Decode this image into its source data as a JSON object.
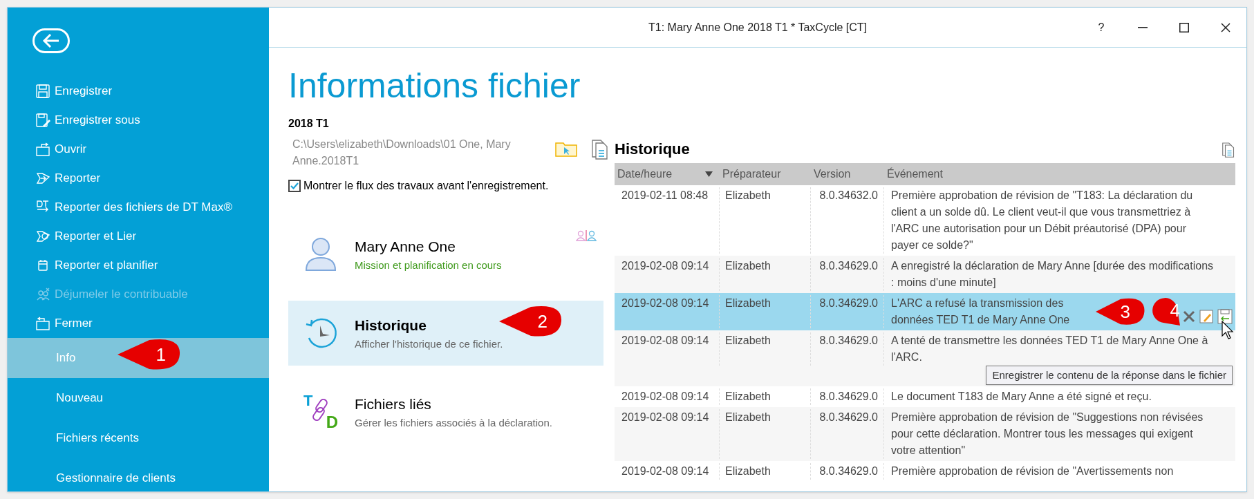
{
  "window": {
    "title": "T1: Mary Anne One 2018 T1 * TaxCycle [CT]",
    "help": "?"
  },
  "sidebar": {
    "items": [
      {
        "label": "Enregistrer",
        "kind": "command",
        "disabled": false,
        "selected": false
      },
      {
        "label": "Enregistrer sous",
        "kind": "command",
        "disabled": false,
        "selected": false
      },
      {
        "label": "Ouvrir",
        "kind": "command",
        "disabled": false,
        "selected": false
      },
      {
        "label": "Reporter",
        "kind": "command",
        "disabled": false,
        "selected": false
      },
      {
        "label": "Reporter des fichiers de DT Max®",
        "kind": "command",
        "disabled": false,
        "selected": false
      },
      {
        "label": "Reporter et Lier",
        "kind": "command",
        "disabled": false,
        "selected": false
      },
      {
        "label": "Reporter et planifier",
        "kind": "command",
        "disabled": false,
        "selected": false
      },
      {
        "label": "Déjumeler le contribuable",
        "kind": "command",
        "disabled": true,
        "selected": false
      },
      {
        "label": "Fermer",
        "kind": "command",
        "disabled": false,
        "selected": false
      },
      {
        "label": "Info",
        "kind": "page",
        "disabled": false,
        "selected": true
      },
      {
        "label": "Nouveau",
        "kind": "page",
        "disabled": false,
        "selected": false
      },
      {
        "label": "Fichiers récents",
        "kind": "page",
        "disabled": false,
        "selected": false
      },
      {
        "label": "Gestionnaire de clients",
        "kind": "page",
        "disabled": false,
        "selected": false
      }
    ]
  },
  "page_title": "Informations fichier",
  "file": {
    "name": "2018 T1",
    "path": "C:\\Users\\elizabeth\\Downloads\\01 One, Mary Anne.2018T1"
  },
  "workflow_checkbox": {
    "label": "Montrer le flux des travaux avant l'enregistrement.",
    "checked": true
  },
  "cards": [
    {
      "kind": "person",
      "title": "Mary Anne One",
      "subtitle": "Mission et planification en cours",
      "selected": false
    },
    {
      "kind": "history",
      "title": "Historique",
      "subtitle": "Afficher l'historique de ce fichier.",
      "selected": true
    },
    {
      "kind": "linked",
      "title": "Fichiers liés",
      "subtitle": "Gérer les fichiers associés à la déclaration.",
      "selected": false
    }
  ],
  "linked_icon_letters": [
    "T",
    "D"
  ],
  "history": {
    "title": "Historique",
    "columns": [
      {
        "label": "Date/heure",
        "sorted": true
      },
      {
        "label": "Préparateur",
        "sorted": false
      },
      {
        "label": "Version",
        "sorted": false
      },
      {
        "label": "Événement",
        "sorted": false
      }
    ],
    "rows": [
      {
        "date": "2019-02-11 08:48",
        "preparer": "Elizabeth",
        "version": "8.0.34632.0",
        "event": "Première approbation de révision de \"T183: La déclaration du client a un solde dû. Le client veut-il que vous transmettriez à l'ARC une autorisation pour un Débit préautorisé (DPA) pour payer ce solde?\"",
        "selected": false
      },
      {
        "date": "2019-02-08 09:14",
        "preparer": "Elizabeth",
        "version": "8.0.34629.0",
        "event": "A enregistré la déclaration de Mary Anne [durée des modifications : moins d'une minute]",
        "selected": false
      },
      {
        "date": "2019-02-08 09:14",
        "preparer": "Elizabeth",
        "version": "8.0.34629.0",
        "event": "L'ARC a refusé la transmission des données TED T1 de Mary Anne One",
        "selected": true
      },
      {
        "date": "2019-02-08 09:14",
        "preparer": "Elizabeth",
        "version": "8.0.34629.0",
        "event": "A tenté de transmettre les données TED T1 de Mary Anne One à l'ARC.",
        "selected": false
      },
      {
        "date": "2019-02-08 09:14",
        "preparer": "Elizabeth",
        "version": "8.0.34629.0",
        "event": "Le document T183 de Mary Anne a été signé et reçu.",
        "selected": false
      },
      {
        "date": "2019-02-08 09:14",
        "preparer": "Elizabeth",
        "version": "8.0.34629.0",
        "event": "Première approbation de révision de \"Suggestions non révisées pour cette déclaration. Montrer tous les messages qui exigent votre attention\"",
        "selected": false
      },
      {
        "date": "2019-02-08 09:14",
        "preparer": "Elizabeth",
        "version": "8.0.34629.0",
        "event": "Première approbation de révision de \"Avertissements non",
        "selected": false
      }
    ],
    "tooltip": "Enregistrer le contenu de la réponse dans le fichier"
  },
  "callouts": [
    {
      "number": "1"
    },
    {
      "number": "2"
    },
    {
      "number": "3"
    },
    {
      "number": "4"
    }
  ]
}
